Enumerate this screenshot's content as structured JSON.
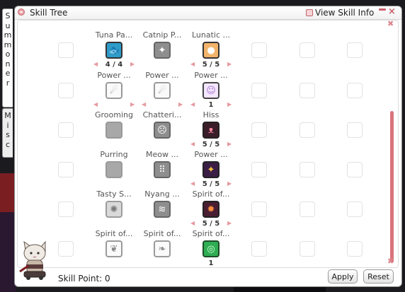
{
  "window": {
    "title": "Skill Tree",
    "view_skill_info_label": "View Skill Info",
    "close_glyph": "×"
  },
  "tabs": [
    {
      "label": "Summoner",
      "letters": [
        "S",
        "u",
        "m",
        "m",
        "o",
        "n",
        "e",
        "r"
      ]
    },
    {
      "label": "Misc",
      "letters": [
        "M",
        "i",
        "s",
        "c"
      ]
    }
  ],
  "skills": [
    {
      "row": 0,
      "col": 1,
      "name": "Tuna Pa...",
      "icon": "tuna-icon",
      "style": "ic-blue",
      "glyph": "🐟",
      "level": "4 / 4",
      "arrows": true
    },
    {
      "row": 0,
      "col": 2,
      "name": "Catnip P...",
      "icon": "catnip-icon",
      "style": "ic-grey",
      "glyph": "✦",
      "level": "",
      "arrows": false
    },
    {
      "row": 0,
      "col": 3,
      "name": "Lunatic ...",
      "icon": "lunatic-icon",
      "style": "ic-orange",
      "glyph": "●",
      "level": "5 / 5",
      "arrows": true
    },
    {
      "row": 1,
      "col": 1,
      "name": "Power ...",
      "icon": "power-outline-icon",
      "style": "ic-outline",
      "glyph": "☄",
      "level": "",
      "arrows": true
    },
    {
      "row": 1,
      "col": 2,
      "name": "Power ...",
      "icon": "power-outline-icon",
      "style": "ic-outline",
      "glyph": "☄",
      "level": "",
      "arrows": true
    },
    {
      "row": 1,
      "col": 3,
      "name": "Power ...",
      "icon": "power-cat-icon",
      "style": "ic-lav",
      "glyph": "☺",
      "level": "1",
      "arrows": true
    },
    {
      "row": 2,
      "col": 1,
      "name": "Grooming",
      "icon": "grooming-icon",
      "style": "ic-grey-dim",
      "glyph": "",
      "level": "",
      "arrows": false
    },
    {
      "row": 2,
      "col": 2,
      "name": "Chatteri...",
      "icon": "chattering-icon",
      "style": "ic-grey",
      "glyph": "☹",
      "level": "",
      "arrows": false
    },
    {
      "row": 2,
      "col": 3,
      "name": "Hiss",
      "icon": "hiss-icon",
      "style": "ic-plum",
      "glyph": "ᴥ",
      "level": "5 / 5",
      "arrows": true
    },
    {
      "row": 3,
      "col": 1,
      "name": "Purring",
      "icon": "purring-icon",
      "style": "ic-grey-dim",
      "glyph": "",
      "level": "",
      "arrows": false
    },
    {
      "row": 3,
      "col": 2,
      "name": "Meow ...",
      "icon": "meow-icon",
      "style": "ic-grey",
      "glyph": "⠿",
      "level": "",
      "arrows": false
    },
    {
      "row": 3,
      "col": 3,
      "name": "Power ...",
      "icon": "power-star-icon",
      "style": "ic-plum2",
      "glyph": "✦",
      "level": "5 / 5",
      "arrows": true
    },
    {
      "row": 4,
      "col": 1,
      "name": "Tasty S...",
      "icon": "tasty-icon",
      "style": "ic-pale",
      "glyph": "✺",
      "level": "",
      "arrows": false
    },
    {
      "row": 4,
      "col": 2,
      "name": "Nyang ...",
      "icon": "nyang-icon",
      "style": "ic-grey",
      "glyph": "≋",
      "level": "",
      "arrows": false
    },
    {
      "row": 4,
      "col": 3,
      "name": "Spirit of...",
      "icon": "spirit-fire-icon",
      "style": "ic-plum3",
      "glyph": "✹",
      "level": "5 / 5",
      "arrows": true
    },
    {
      "row": 5,
      "col": 1,
      "name": "Spirit of...",
      "icon": "spirit-leaf-icon",
      "style": "ic-outline",
      "glyph": "❦",
      "level": "",
      "arrows": false
    },
    {
      "row": 5,
      "col": 2,
      "name": "Spirit of...",
      "icon": "spirit-wing-icon",
      "style": "ic-outline",
      "glyph": "❧",
      "level": "",
      "arrows": false
    },
    {
      "row": 5,
      "col": 3,
      "name": "Spirit of...",
      "icon": "spirit-earth-icon",
      "style": "ic-green",
      "glyph": "◎",
      "level": "1",
      "arrows": false
    }
  ],
  "empty_slot_columns": [
    0,
    4,
    5,
    6
  ],
  "footer": {
    "skill_point_label": "Skill Point: 0",
    "apply_label": "Apply",
    "reset_label": "Reset"
  },
  "arrow_glyphs": {
    "left": "◀",
    "right": "▶"
  }
}
